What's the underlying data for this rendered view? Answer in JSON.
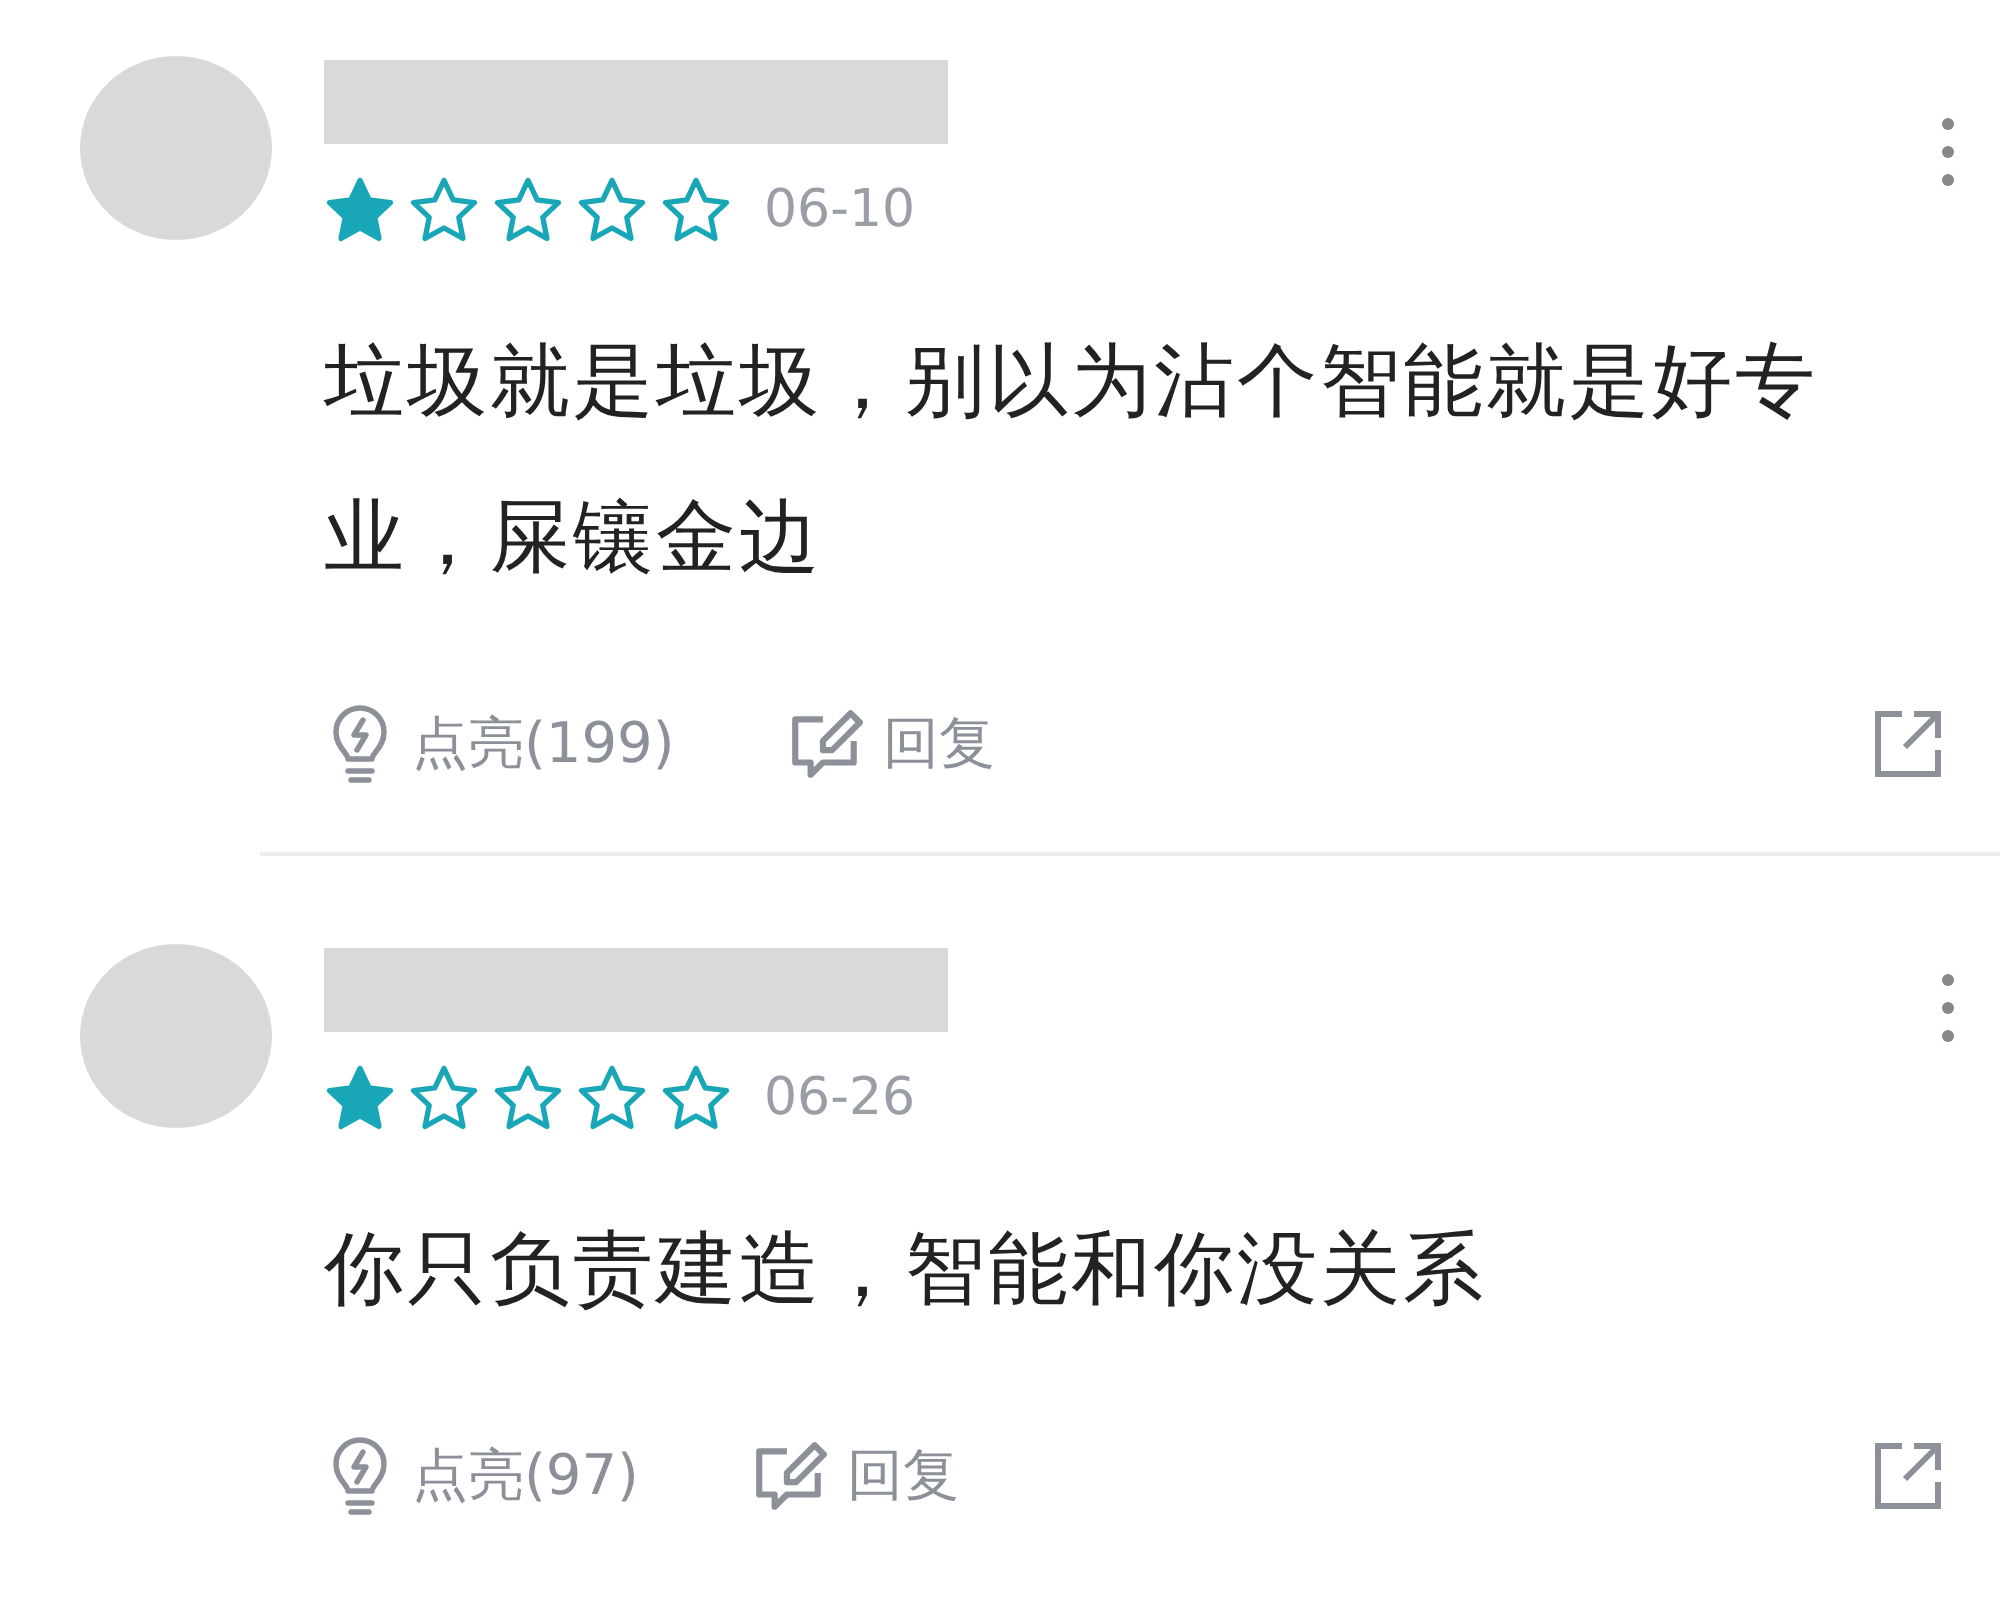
{
  "comments": [
    {
      "stars": 1,
      "date": "06-10",
      "text": "垃圾就是垃圾，别以为沾个智能就是好专业，屎镶金边",
      "like": "点亮(199)",
      "reply": "回复"
    },
    {
      "stars": 1,
      "date": "06-26",
      "text": "你只负责建造，智能和你没关系",
      "like": "点亮(97)",
      "reply": "回复"
    }
  ]
}
